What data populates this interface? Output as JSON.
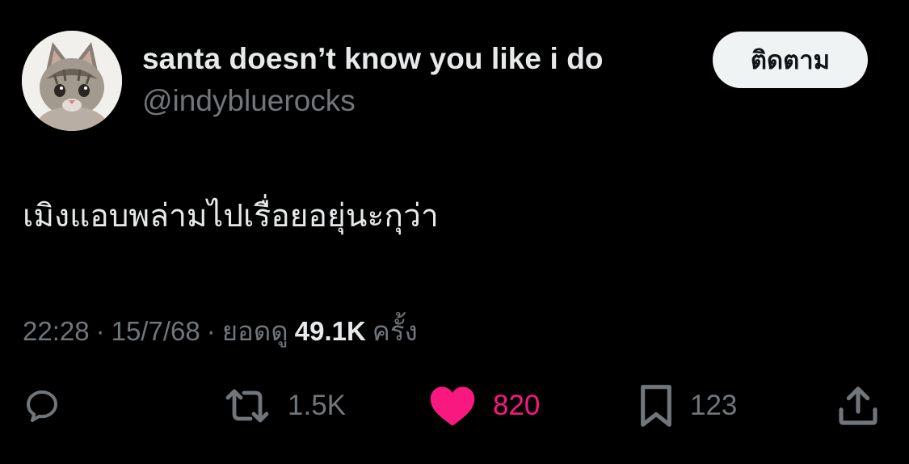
{
  "author": {
    "display_name": "santa doesn’t know you like i do",
    "handle": "@indybluerocks",
    "avatar_icon": "kitten-avatar"
  },
  "follow_button": {
    "label": "ติดตาม"
  },
  "tweet": {
    "text": "เมิงแอบพล่ามไปเรื่อยอยุ่นะกุว่า"
  },
  "meta": {
    "time": "22:28",
    "separator": "·",
    "date": "15/7/68",
    "views_prefix": "ยอดดู",
    "views_count": "49.1K",
    "views_suffix": "ครั้ง"
  },
  "actions": {
    "reply": {
      "icon": "reply-icon",
      "count": ""
    },
    "retweet": {
      "icon": "retweet-icon",
      "count": "1.5K"
    },
    "like": {
      "icon": "heart-icon",
      "count": "820",
      "liked": true
    },
    "bookmark": {
      "icon": "bookmark-icon",
      "count": "123"
    },
    "share": {
      "icon": "share-icon"
    }
  },
  "colors": {
    "background": "#000000",
    "primary_text": "#e7e9ea",
    "secondary_text": "#71767b",
    "like_pink": "#f91880",
    "follow_button_bg": "#eff3f4"
  }
}
